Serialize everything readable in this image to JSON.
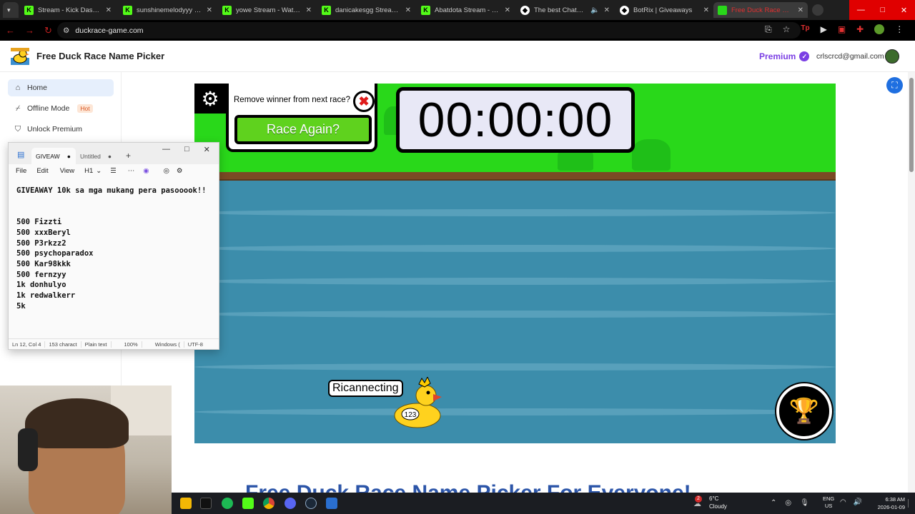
{
  "browser": {
    "tabs": [
      {
        "title": "Stream - Kick Dashboard",
        "favicon": "kick-icon",
        "active": false
      },
      {
        "title": "sunshinemelodyyy Stream",
        "favicon": "kick-icon",
        "active": false
      },
      {
        "title": "yowe Stream - Watch Live",
        "favicon": "kick-icon",
        "active": false
      },
      {
        "title": "danicakesgg Stream - We",
        "favicon": "kick-icon",
        "active": false
      },
      {
        "title": "Abatdota Stream - Watch",
        "favicon": "kick-icon",
        "active": false
      },
      {
        "title": "The best ChatBot and",
        "favicon": "chatbot-icon",
        "active": false
      },
      {
        "title": "BotRix | Giveaways",
        "favicon": "botrix-icon",
        "active": false
      },
      {
        "title": "Free Duck Race Name",
        "favicon": "duck-icon",
        "active": true
      }
    ],
    "url": "duckrace-game.com"
  },
  "site": {
    "title": "Free Duck Race Name Picker",
    "premium_label": "Premium",
    "user_email": "crlscrcd@gmail.com"
  },
  "sidebar": {
    "items": [
      {
        "label": "Home",
        "icon": "home-icon"
      },
      {
        "label": "Offline Mode",
        "icon": "offline-icon",
        "badge": "Hot"
      },
      {
        "label": "Unlock Premium",
        "icon": "shield-check-icon"
      }
    ]
  },
  "game": {
    "remove_winner_question": "Remove winner from next race?",
    "race_again_label": "Race Again?",
    "timer": "00:00:00",
    "duck_name": "Ricannecting",
    "duck_number": "123",
    "colors": {
      "grass": "#29d81a",
      "water": "#3c8dab",
      "button": "#5fd21e",
      "close": "#e01b1b"
    }
  },
  "below": {
    "heading": "Free Duck Race Name Picker For Everyone!"
  },
  "notepad": {
    "tabs": [
      {
        "title": "GIVEAW",
        "active": true
      },
      {
        "title": "Untitled",
        "active": false
      }
    ],
    "menu": [
      "File",
      "Edit",
      "View",
      "H1"
    ],
    "lines": [
      "GIVEAWAY 10k sa mga mukang pera pasooook!!",
      "",
      "",
      "500 Fizzti",
      "500 xxxBeryl",
      "500 P3rkzz2",
      "500 psychoparadox",
      "500 Kar98kkk",
      "500 fernzyy",
      "1k donhulyo",
      "1k redwalkerr",
      "5k "
    ],
    "status": {
      "position": "Ln 12, Col 4",
      "chars": "153 charact",
      "format": "Plain text",
      "zoom": "100%",
      "eol": "Windows (",
      "encoding": "UTF-8"
    }
  },
  "taskbar": {
    "weather_badge": "2",
    "temperature": "6°C",
    "condition": "Cloudy",
    "lang_top": "ENG",
    "lang_bottom": "US",
    "time": "6:38 AM",
    "date": "2026-01-09"
  }
}
